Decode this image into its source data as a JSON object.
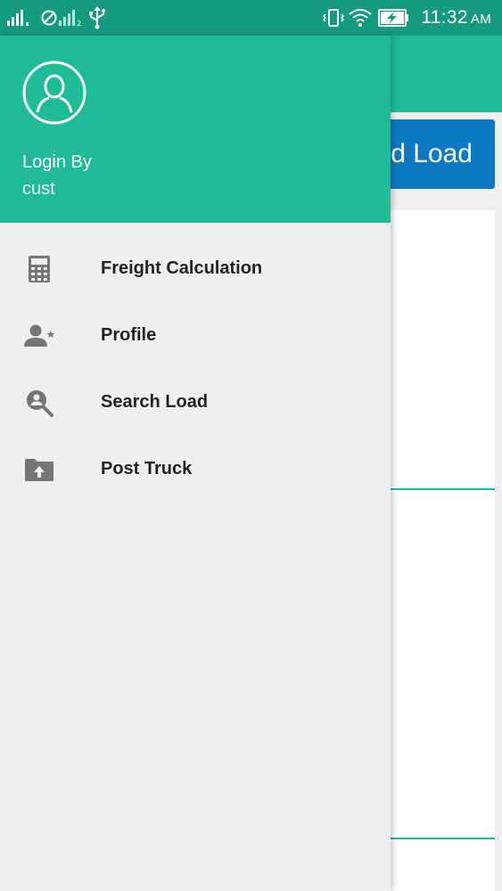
{
  "status_bar": {
    "time": "11:32",
    "ampm": "AM",
    "icons": [
      "signal-icon",
      "no-sim-icon",
      "signal-2-icon",
      "usb-icon",
      "vibrate-icon",
      "wifi-icon",
      "battery-charging-icon"
    ]
  },
  "background_app": {
    "primary_button_label": "d Load"
  },
  "drawer": {
    "header": {
      "avatar_icon": "account-circle-icon",
      "login_label": "Login By",
      "login_user": "cust"
    },
    "items": [
      {
        "label": "Freight Calculation",
        "icon": "calculator-icon"
      },
      {
        "label": "Profile",
        "icon": "person-star-icon"
      },
      {
        "label": "Search Load",
        "icon": "search-person-icon"
      },
      {
        "label": "Post Truck",
        "icon": "folder-upload-icon"
      }
    ]
  },
  "colors": {
    "status_bar": "#169a7e",
    "accent": "#1fbb97",
    "button_blue": "#0d79c3",
    "drawer_bg": "#efeef0",
    "icon_gray": "#757575"
  }
}
